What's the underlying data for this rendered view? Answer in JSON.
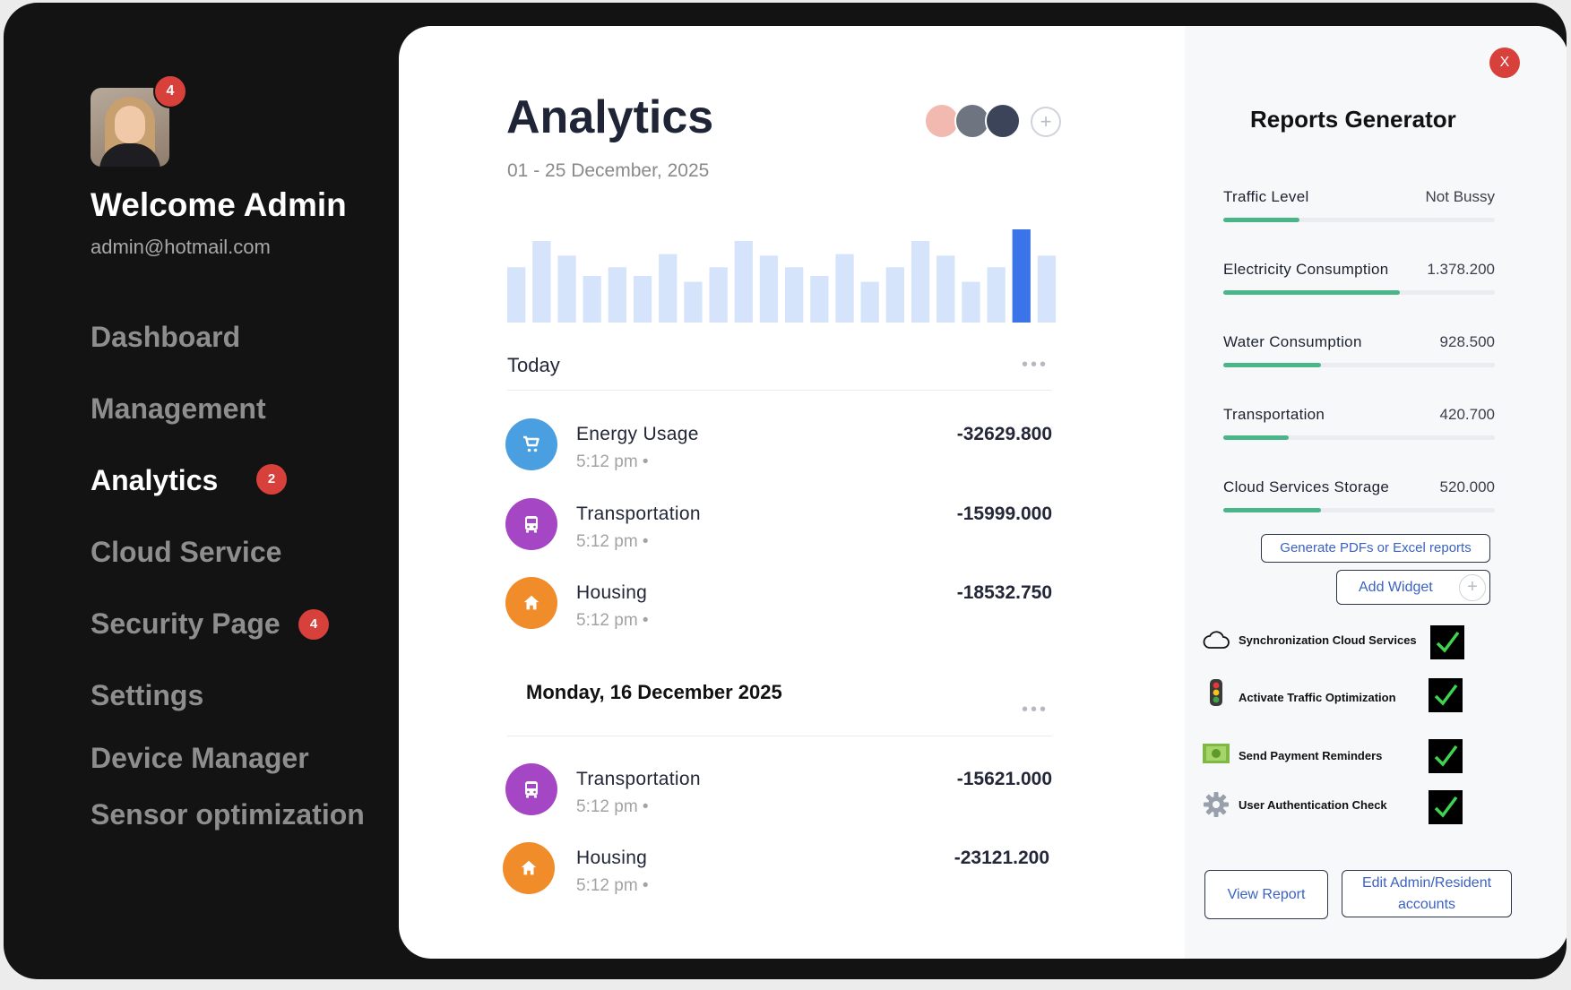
{
  "sidebar": {
    "avatar_badge": "4",
    "welcome": "Welcome Admin",
    "email": "admin@hotmail.com",
    "nav": [
      {
        "label": "Dashboard",
        "badge": ""
      },
      {
        "label": "Management",
        "badge": ""
      },
      {
        "label": "Analytics",
        "badge": "2"
      },
      {
        "label": "Cloud Service",
        "badge": ""
      },
      {
        "label": "Security Page",
        "badge": "4"
      },
      {
        "label": "Settings",
        "badge": ""
      },
      {
        "label": "Device Manager",
        "badge": ""
      },
      {
        "label": "Sensor optimization",
        "badge": ""
      }
    ]
  },
  "main": {
    "title": "Analytics",
    "date_range": "01 - 25 December, 2025",
    "add_member": "+",
    "today_label": "Today",
    "dots": "•••",
    "today_transactions": [
      {
        "name": "Energy Usage",
        "time": "5:12 pm  •",
        "amount": "-32629.800",
        "icon": "cart-icon"
      },
      {
        "name": "Transportation",
        "time": "5:12 pm  •",
        "amount": "-15999.000",
        "icon": "bus-icon"
      },
      {
        "name": "Housing",
        "time": "5:12 pm  •",
        "amount": "-18532.750",
        "icon": "home-icon"
      }
    ],
    "day2_label": "Monday, 16 December 2025",
    "day2_transactions": [
      {
        "name": "Transportation",
        "time": "5:12 pm  •",
        "amount": "-15621.000",
        "icon": "bus-icon"
      },
      {
        "name": "Housing",
        "time": "5:12 pm  •",
        "amount": "-23121.200",
        "icon": "home-icon"
      }
    ]
  },
  "colors": {
    "accent_blue": "#3b74e8",
    "bar_light": "#d6e4fb",
    "cart": "#4a9fe0",
    "bus": "#a546c4",
    "home": "#f08c2a",
    "progress": "#4bb58a",
    "badge": "#d8403b"
  },
  "chart_data": {
    "type": "bar",
    "values": [
      38,
      56,
      46,
      32,
      38,
      32,
      47,
      28,
      38,
      56,
      46,
      38,
      32,
      47,
      28,
      38,
      56,
      46,
      28,
      38,
      64,
      46
    ],
    "highlight_index": 20
  },
  "reports": {
    "close": "X",
    "title": "Reports Generator",
    "metrics": [
      {
        "label": "Traffic Level",
        "value": "Not Bussy",
        "progress": 0.28
      },
      {
        "label": "Electricity Consumption",
        "value": "1.378.200",
        "progress": 0.65
      },
      {
        "label": "Water Consumption",
        "value": "928.500",
        "progress": 0.36
      },
      {
        "label": "Transportation",
        "value": "420.700",
        "progress": 0.24
      },
      {
        "label": "Cloud Services Storage",
        "value": "520.000",
        "progress": 0.36
      }
    ],
    "generate_btn": "Generate PDFs or Excel reports",
    "add_widget_btn": "Add Widget",
    "add_widget_plus": "+",
    "checks": [
      {
        "label": "Synchronization Cloud Services",
        "icon": "cloud-icon",
        "checked": true
      },
      {
        "label": "Activate Traffic Optimization",
        "icon": "traffic-light-icon",
        "checked": true
      },
      {
        "label": "Send Payment Reminders",
        "icon": "money-icon",
        "checked": true
      },
      {
        "label": "User Authentication Check",
        "icon": "gear-icon",
        "checked": true
      }
    ],
    "view_report_btn": "View Report",
    "edit_accounts_btn": "Edit Admin/Resident accounts"
  }
}
